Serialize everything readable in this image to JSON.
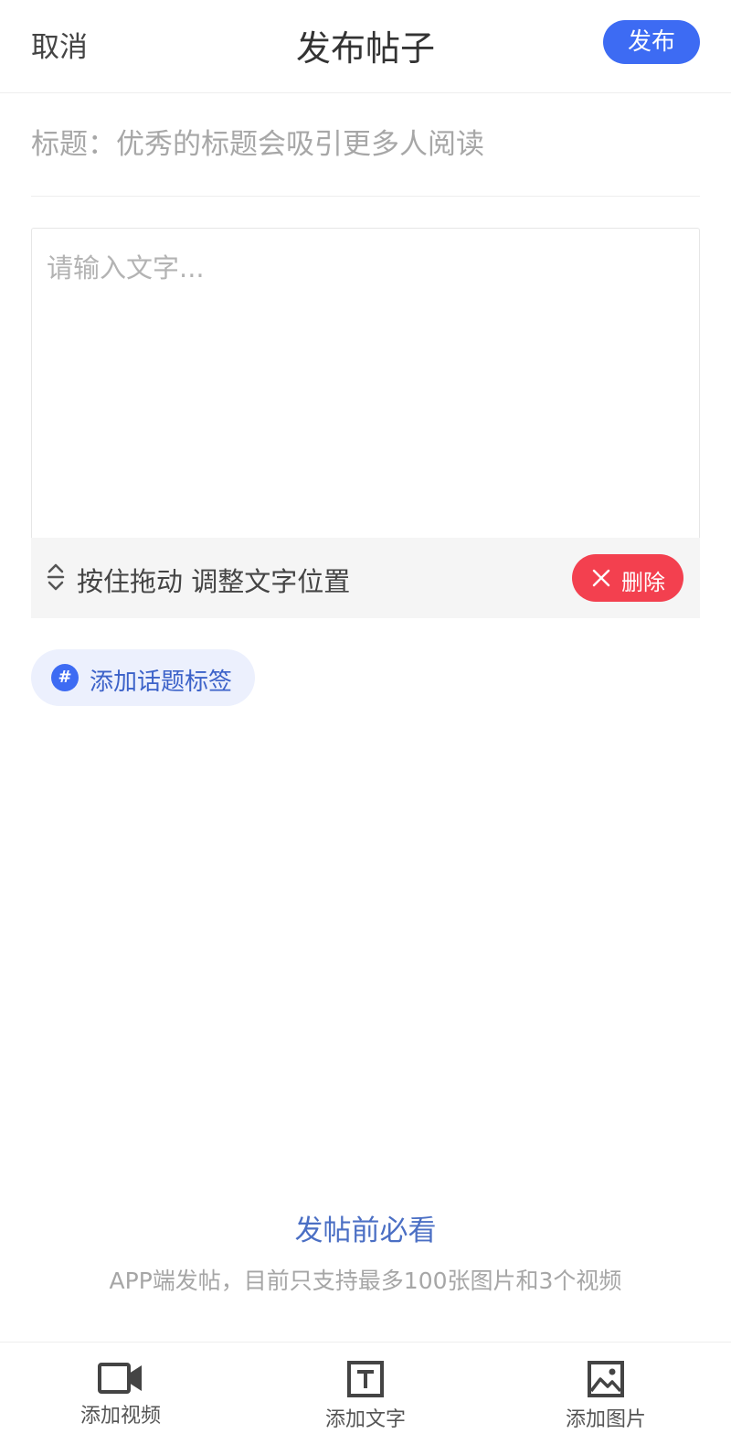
{
  "header": {
    "cancel_label": "取消",
    "title": "发布帖子",
    "publish_label": "发布"
  },
  "title_field": {
    "placeholder": "标题：优秀的标题会吸引更多人阅读",
    "value": ""
  },
  "text_block": {
    "placeholder": "请输入文字...",
    "value": "",
    "drag_hint": "按住拖动 调整文字位置",
    "delete_label": "删除"
  },
  "topic_tag": {
    "label": "添加话题标签",
    "icon": "#"
  },
  "notice": {
    "link_label": "发帖前必看",
    "text": "APP端发帖，目前只支持最多100张图片和3个视频"
  },
  "toolbar": {
    "items": [
      {
        "label": "添加视频",
        "icon": "video-icon"
      },
      {
        "label": "添加文字",
        "icon": "text-icon"
      },
      {
        "label": "添加图片",
        "icon": "image-icon"
      }
    ]
  },
  "colors": {
    "accent": "#3d6bf3",
    "danger": "#f3404f",
    "tag_bg": "#ecf0fd",
    "link": "#4b6fc4"
  }
}
